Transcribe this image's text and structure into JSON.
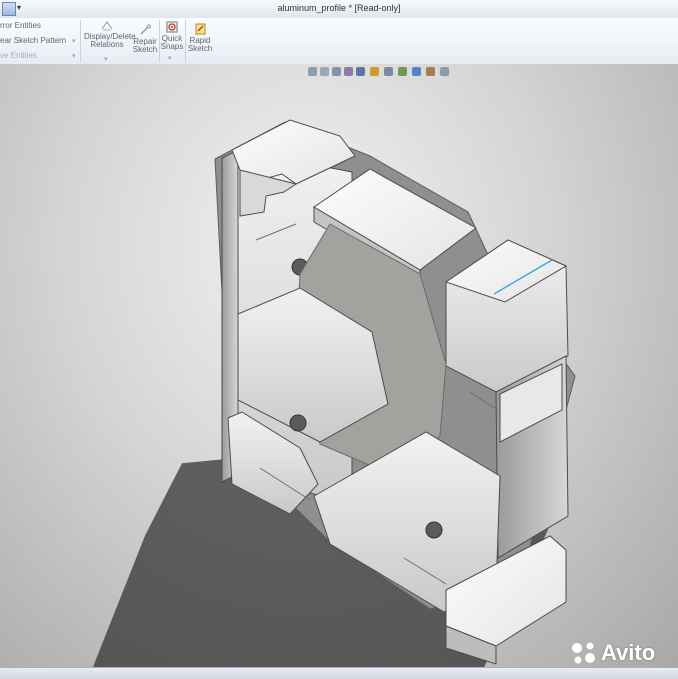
{
  "window": {
    "title": "aluminum_profile * [Read-only]"
  },
  "ribbon": {
    "left_commands": [
      "rror Entities",
      "ear Sketch Pattern",
      "ve Entities"
    ],
    "display_delete_relations": "Display/Delete\nRelations",
    "repair_sketch": "Repair\nSketch",
    "quick_snaps": "Quick\nSnaps",
    "rapid_sketch": "Rapid\nSketch"
  },
  "watermark": {
    "text": "Avito"
  },
  "colors": {
    "avito_dot_1": "#ffffff",
    "avito_dot_2": "#ffffff",
    "avito_dot_3": "#ffffff",
    "avito_dot_4": "#ffffff"
  }
}
